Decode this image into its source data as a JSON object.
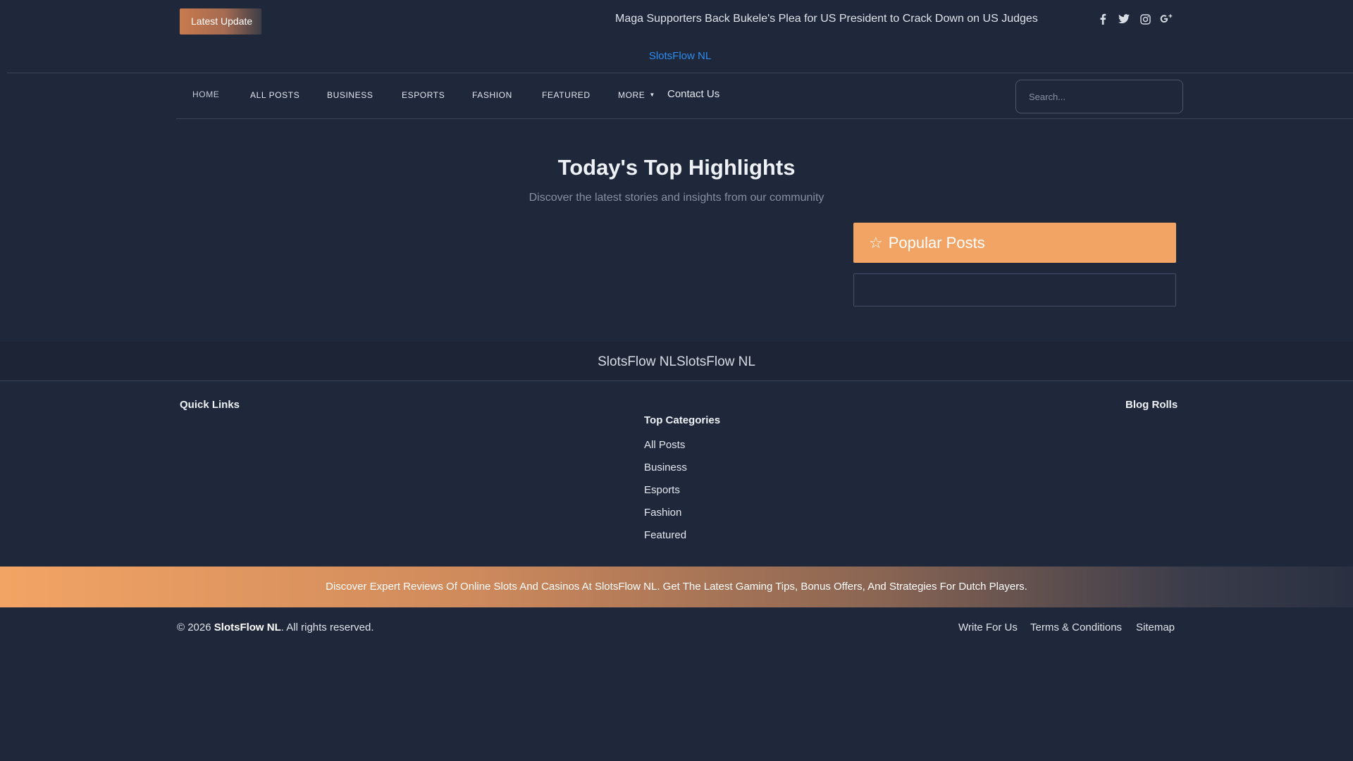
{
  "topbar": {
    "latest_label": "Latest Update",
    "ticker_text": "Maga Supporters Back Bukele's Plea for US President to Crack Down on US Judges",
    "socials": [
      "facebook-icon",
      "twitter-icon",
      "instagram-icon",
      "google-plus-icon"
    ]
  },
  "site": {
    "name": "SlotsFlow NL"
  },
  "nav": {
    "items": [
      {
        "label": "Home"
      },
      {
        "label": "All Posts"
      },
      {
        "label": "Business"
      },
      {
        "label": "Esports"
      },
      {
        "label": "Fashion"
      },
      {
        "label": "Featured"
      },
      {
        "label": "More"
      }
    ],
    "contact_label": "Contact Us",
    "search_placeholder": "Search..."
  },
  "hero": {
    "title": "Today's Top Highlights",
    "subtitle": "Discover the latest stories and insights from our community"
  },
  "popular": {
    "title": "Popular Posts"
  },
  "footer": {
    "brand": "SlotsFlow NLSlotsFlow NL",
    "quick_links_title": "Quick Links",
    "top_categories_title": "Top Categories",
    "blog_rolls_title": "Blog Rolls",
    "categories": [
      "All Posts",
      "Business",
      "Esports",
      "Fashion",
      "Featured"
    ],
    "promo": "Discover Expert Reviews Of Online Slots And Casinos At SlotsFlow NL. Get The Latest Gaming Tips, Bonus Offers, And Strategies For Dutch Players.",
    "copyright_prefix": "© 2026",
    "copyright_brand": "SlotsFlow NL",
    "copyright_suffix": ". All rights reserved.",
    "bottom_links": [
      "Write For Us",
      "Terms & Conditions",
      "Sitemap"
    ]
  },
  "colors": {
    "background": "#1f273a",
    "accent": "#f2a464",
    "link": "#2d8cf0"
  }
}
